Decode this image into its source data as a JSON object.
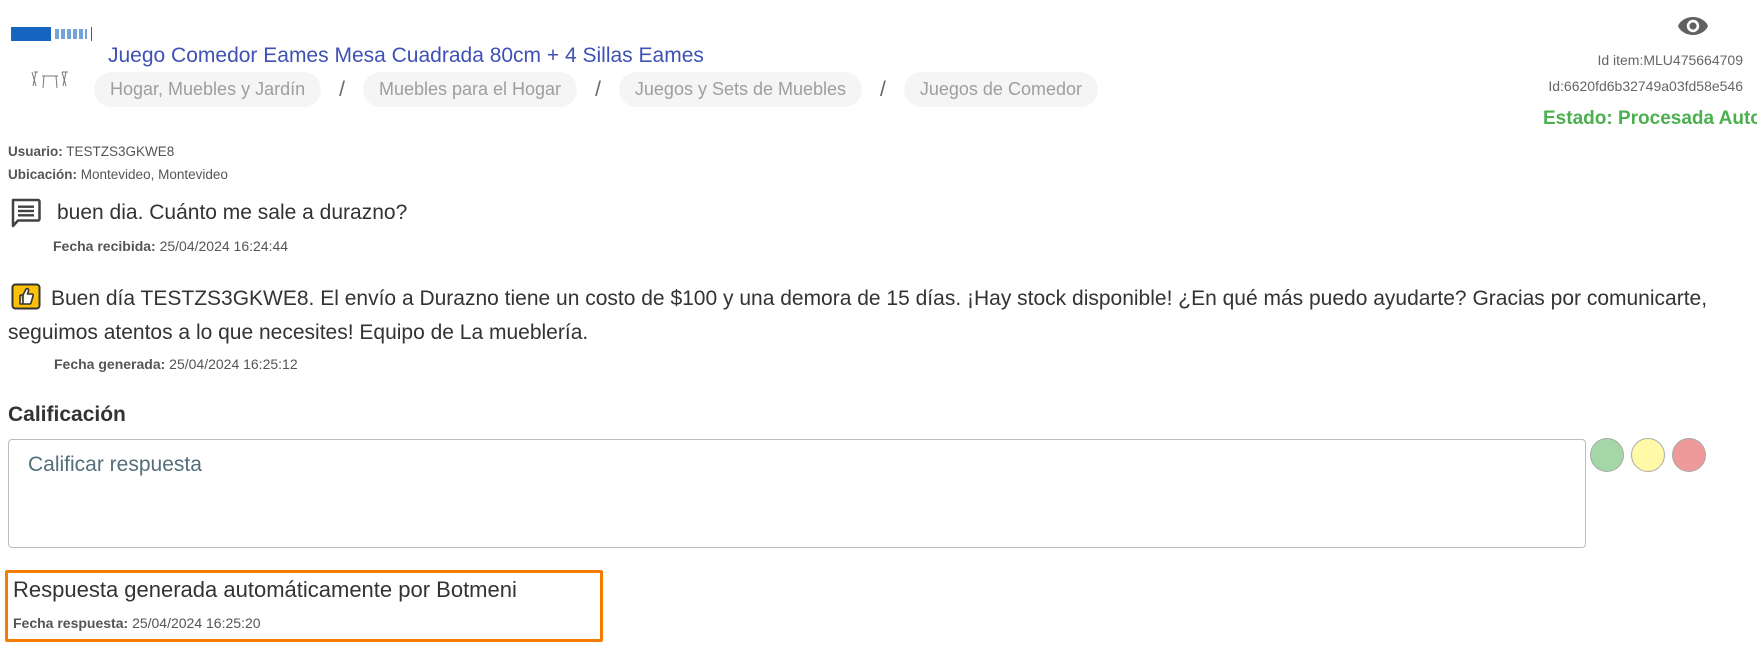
{
  "item": {
    "title": "Juego Comedor Eames Mesa Cuadrada 80cm + 4 Sillas Eames",
    "breadcrumbs": [
      "Hogar, Muebles y Jardín",
      "Muebles para el Hogar",
      "Juegos y Sets de Muebles",
      "Juegos de Comedor"
    ],
    "breadcrumb_separator": "/"
  },
  "meta": {
    "id_item": "Id item:MLU475664709",
    "id_hash": "Id:6620fd6b32749a03fd58e546",
    "estado": "Estado: Procesada Automática",
    "estado_color": "#4caf50"
  },
  "user": {
    "usuario_label": "Usuario:",
    "usuario_value": "TESTZS3GKWE8",
    "ubicacion_label": "Ubicación:",
    "ubicacion_value": "Montevideo, Montevideo"
  },
  "question": {
    "text": "buen dia. Cuánto me sale a durazno?",
    "date_label": "Fecha recibida:",
    "date_value": "25/04/2024 16:24:44"
  },
  "answer": {
    "text": "Buen día TESTZS3GKWE8. El envío a Durazno tiene un costo de $100 y una demora de 15 días. ¡Hay stock disponible! ¿En qué más puedo ayudarte? Gracias por comunicarte, seguimos atentos a lo que necesites! Equipo de La mueblería.",
    "date_label": "Fecha generada:",
    "date_value": "25/04/2024 16:25:12"
  },
  "rating": {
    "label": "Calificación",
    "placeholder": "Calificar respuesta",
    "colors": [
      "#a5d6a7",
      "#fff9a8",
      "#ef9a9a"
    ]
  },
  "response": {
    "title": "Respuesta generada automáticamente por Botmeni",
    "date_label": "Fecha respuesta:",
    "date_value": "25/04/2024 16:25:20",
    "border_color": "#f57c00"
  },
  "icons": {
    "logo": "brand-logo",
    "thumbnail": "product-thumbnail",
    "visibility": "eye-icon",
    "question": "chat-icon",
    "answer": "thumbs-up-icon"
  },
  "accent": "#3f51b5"
}
